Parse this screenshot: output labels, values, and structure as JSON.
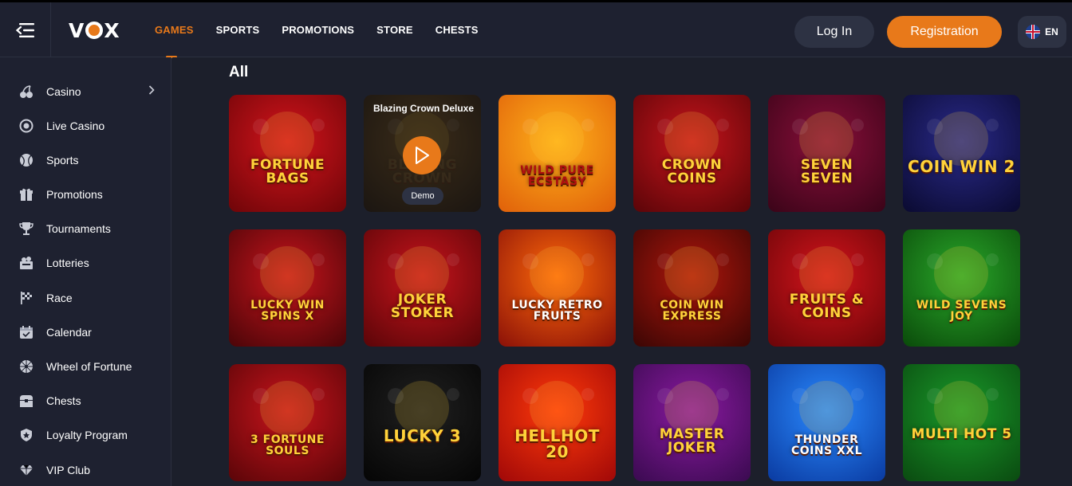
{
  "header": {
    "logo_text_v": "V",
    "logo_text_x": "X",
    "nav": [
      "GAMES",
      "SPORTS",
      "PROMOTIONS",
      "STORE",
      "CHESTS"
    ],
    "login_label": "Log In",
    "register_label": "Registration",
    "lang_label": "EN",
    "accent": "#e8791a"
  },
  "sidebar": {
    "items": [
      {
        "label": "Casino",
        "icon": "cherries-icon"
      },
      {
        "label": "Live Casino",
        "icon": "chip-icon"
      },
      {
        "label": "Sports",
        "icon": "ball-icon"
      },
      {
        "label": "Promotions",
        "icon": "gift-icon"
      },
      {
        "label": "Tournaments",
        "icon": "trophy-icon"
      },
      {
        "label": "Lotteries",
        "icon": "lottery-icon"
      },
      {
        "label": "Race",
        "icon": "flag-icon"
      },
      {
        "label": "Calendar",
        "icon": "calendar-icon"
      },
      {
        "label": "Wheel of Fortune",
        "icon": "wheel-icon"
      },
      {
        "label": "Chests",
        "icon": "chest-icon"
      },
      {
        "label": "Loyalty Program",
        "icon": "medal-icon"
      },
      {
        "label": "VIP Club",
        "icon": "diamond-icon"
      }
    ]
  },
  "main": {
    "section_title": "All",
    "hovered_game": {
      "title": "Blazing Crown Deluxe",
      "demo_label": "Demo"
    },
    "games": [
      {
        "name": "FORTUNE BAGS",
        "colors": [
          "#d4141c",
          "#6e0508"
        ],
        "text": "#ffd23a"
      },
      {
        "name": "BLAZING CROWN",
        "colors": [
          "#6a4a18",
          "#241808"
        ],
        "text": "#8a6a30"
      },
      {
        "name": "WILD PURE ECSTASY",
        "colors": [
          "#ffb21a",
          "#e0600a"
        ],
        "text": "#b01010"
      },
      {
        "name": "CROWN COINS",
        "colors": [
          "#c8141c",
          "#5a0508"
        ],
        "text": "#ffd23a"
      },
      {
        "name": "SEVEN SEVEN",
        "colors": [
          "#8a0f3a",
          "#3a0418"
        ],
        "text": "#ffd23a"
      },
      {
        "name": "COIN WIN 2",
        "colors": [
          "#2a2a8a",
          "#0a0a30"
        ],
        "text": "#ffd23a"
      },
      {
        "name": "LUCKY WIN SPINS X",
        "colors": [
          "#c8141c",
          "#4a0508"
        ],
        "text": "#ffd23a"
      },
      {
        "name": "JOKER STOKER",
        "colors": [
          "#c8141c",
          "#5a0508"
        ],
        "text": "#ffd23a"
      },
      {
        "name": "LUCKY RETRO FRUITS",
        "colors": [
          "#ff6a0a",
          "#8a1008"
        ],
        "text": "#ffffff"
      },
      {
        "name": "COIN WIN EXPRESS",
        "colors": [
          "#b0160c",
          "#3a0604"
        ],
        "text": "#ffd23a"
      },
      {
        "name": "FRUITS & COINS",
        "colors": [
          "#d4141c",
          "#6a0508"
        ],
        "text": "#ffd23a"
      },
      {
        "name": "WILD SEVENS JOY",
        "colors": [
          "#2aa82a",
          "#0a4a0a"
        ],
        "text": "#ffd23a"
      },
      {
        "name": "3 FORTUNE SOULS",
        "colors": [
          "#c8141c",
          "#5a0508"
        ],
        "text": "#ffd23a"
      },
      {
        "name": "LUCKY 3",
        "colors": [
          "#202020",
          "#050505"
        ],
        "text": "#ffd23a"
      },
      {
        "name": "HELLHOT 20",
        "colors": [
          "#ff3a0a",
          "#a00808"
        ],
        "text": "#ffd23a"
      },
      {
        "name": "MASTER JOKER",
        "colors": [
          "#8a1aa0",
          "#3a0a50"
        ],
        "text": "#ffd23a"
      },
      {
        "name": "THUNDER COINS XXL",
        "colors": [
          "#2a8aff",
          "#0a3aa0"
        ],
        "text": "#ffffff"
      },
      {
        "name": "MULTI HOT 5",
        "colors": [
          "#1a9a2a",
          "#0a4a10"
        ],
        "text": "#ffd23a"
      }
    ]
  }
}
